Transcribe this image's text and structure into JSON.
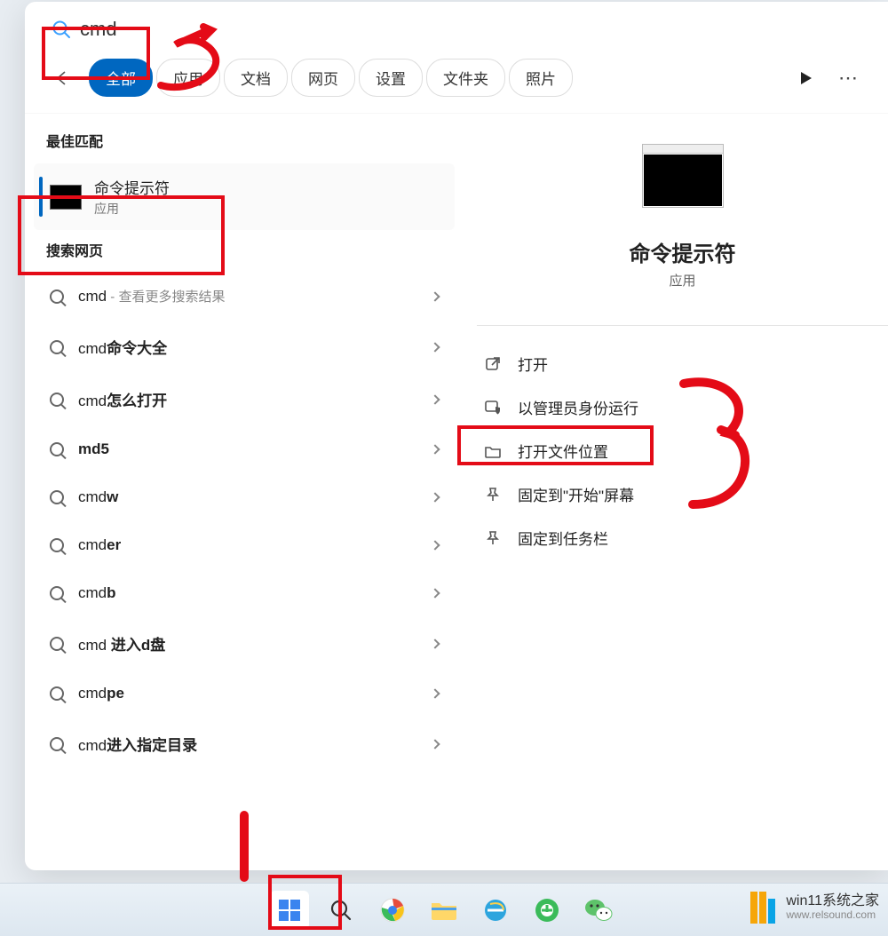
{
  "search": {
    "value": "cmd"
  },
  "tabs": {
    "all": "全部",
    "apps": "应用",
    "docs": "文档",
    "web": "网页",
    "settings": "设置",
    "folders": "文件夹",
    "photos": "照片"
  },
  "sections": {
    "best_match": "最佳匹配",
    "web_search": "搜索网页"
  },
  "best_match": {
    "title": "命令提示符",
    "subtitle": "应用"
  },
  "web_results": [
    {
      "prefix": "cmd",
      "suffix": " - 查看更多搜索结果"
    },
    {
      "prefix": "cmd",
      "bold": "命令大全",
      "suffix": ""
    },
    {
      "prefix": "cmd",
      "bold": "怎么打开",
      "suffix": ""
    },
    {
      "prefix": "",
      "bold": "md5",
      "suffix": ""
    },
    {
      "prefix": "cmd",
      "bold": "w",
      "suffix": ""
    },
    {
      "prefix": "cmd",
      "bold": "er",
      "suffix": ""
    },
    {
      "prefix": "cmd",
      "bold": "b",
      "suffix": ""
    },
    {
      "prefix": "cmd",
      "bold": " 进入d盘",
      "suffix": ""
    },
    {
      "prefix": "cmd",
      "bold": "pe",
      "suffix": ""
    },
    {
      "prefix": "cmd",
      "bold": "进入指定目录",
      "suffix": ""
    }
  ],
  "preview": {
    "title": "命令提示符",
    "subtitle": "应用"
  },
  "actions": {
    "open": "打开",
    "run_admin": "以管理员身份运行",
    "open_location": "打开文件位置",
    "pin_start": "固定到\"开始\"屏幕",
    "pin_taskbar": "固定到任务栏"
  },
  "watermark": {
    "title": "win11系统之家",
    "sub": "www.relsound.com"
  },
  "annotations": {
    "step1": "1",
    "step2": "2",
    "step3": "3"
  }
}
